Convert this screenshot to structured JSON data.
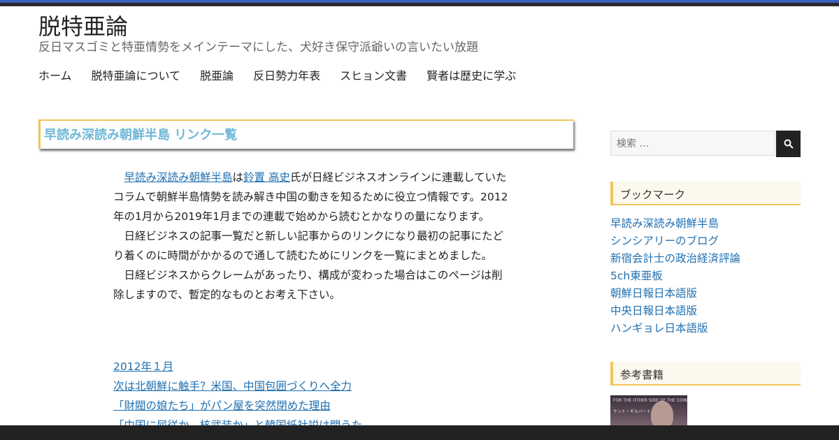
{
  "site": {
    "title": "脱特亜論",
    "description": "反日マスゴミと特亜情勢をメインテーマにした、犬好き保守派爺いの言いたい放題"
  },
  "nav": {
    "items": [
      {
        "label": "ホーム"
      },
      {
        "label": "脱特亜論について"
      },
      {
        "label": "脱亜論"
      },
      {
        "label": "反日勢力年表"
      },
      {
        "label": "スヒョン文書"
      },
      {
        "label": "賢者は歴史に学ぶ"
      }
    ]
  },
  "article": {
    "title": "早読み深読み朝鮮半島 リンク一覧",
    "intro": {
      "link1": "早読み深読み朝鮮半島",
      "text1": "は",
      "link2": "鈴置 高史",
      "text2": "氏が日経ビジネスオンラインに連載していたコラムで朝鮮半島情勢を読み解き中国の動きを知るために役立つ情報です。2012年の1月から2019年1月までの連載で始めから読むとかなりの量になります。"
    },
    "para2": "日経ビジネスの記事一覧だと新しい記事からのリンクになり最初の記事にたどり着くのに時間がかかるので通して読むためにリンクを一覧にまとめました。",
    "para3": "日経ビジネスからクレームがあったり、構成が変わった場合はこのページは削除しますので、暫定的なものとお考え下さい。",
    "links": [
      {
        "label": "2012年１月"
      },
      {
        "label": "次は北朝鮮に触手？米国、中国包囲づくりへ全力"
      },
      {
        "label": "「財閥の娘たち」がパン屋を突然閉めた理由"
      },
      {
        "label": "「中国に屈従か、核武装か」と韓国紙社説は問うた"
      }
    ]
  },
  "sidebar": {
    "search": {
      "placeholder": "検索 …"
    },
    "bookmarks": {
      "title": "ブックマーク",
      "items": [
        {
          "label": "早読み深読み朝鮮半島"
        },
        {
          "label": "シンシアリーのブログ"
        },
        {
          "label": "新宿会計士の政治経済評論"
        },
        {
          "label": "5ch東亜板"
        },
        {
          "label": "朝鮮日報日本語版"
        },
        {
          "label": "中央日報日本語版"
        },
        {
          "label": "ハンギョレ日本語版"
        }
      ]
    },
    "books": {
      "title": "参考書籍",
      "cover_text_1": "FOR THE OTHER SIDE OF THE COIN",
      "cover_text_2": "ケント・ギルバート"
    }
  },
  "colors": {
    "accent_gold": "#f1c65a",
    "title_blue": "#6fb8d8",
    "link_blue": "#1f6fb0",
    "top_stripe": "#3b5fbd"
  }
}
